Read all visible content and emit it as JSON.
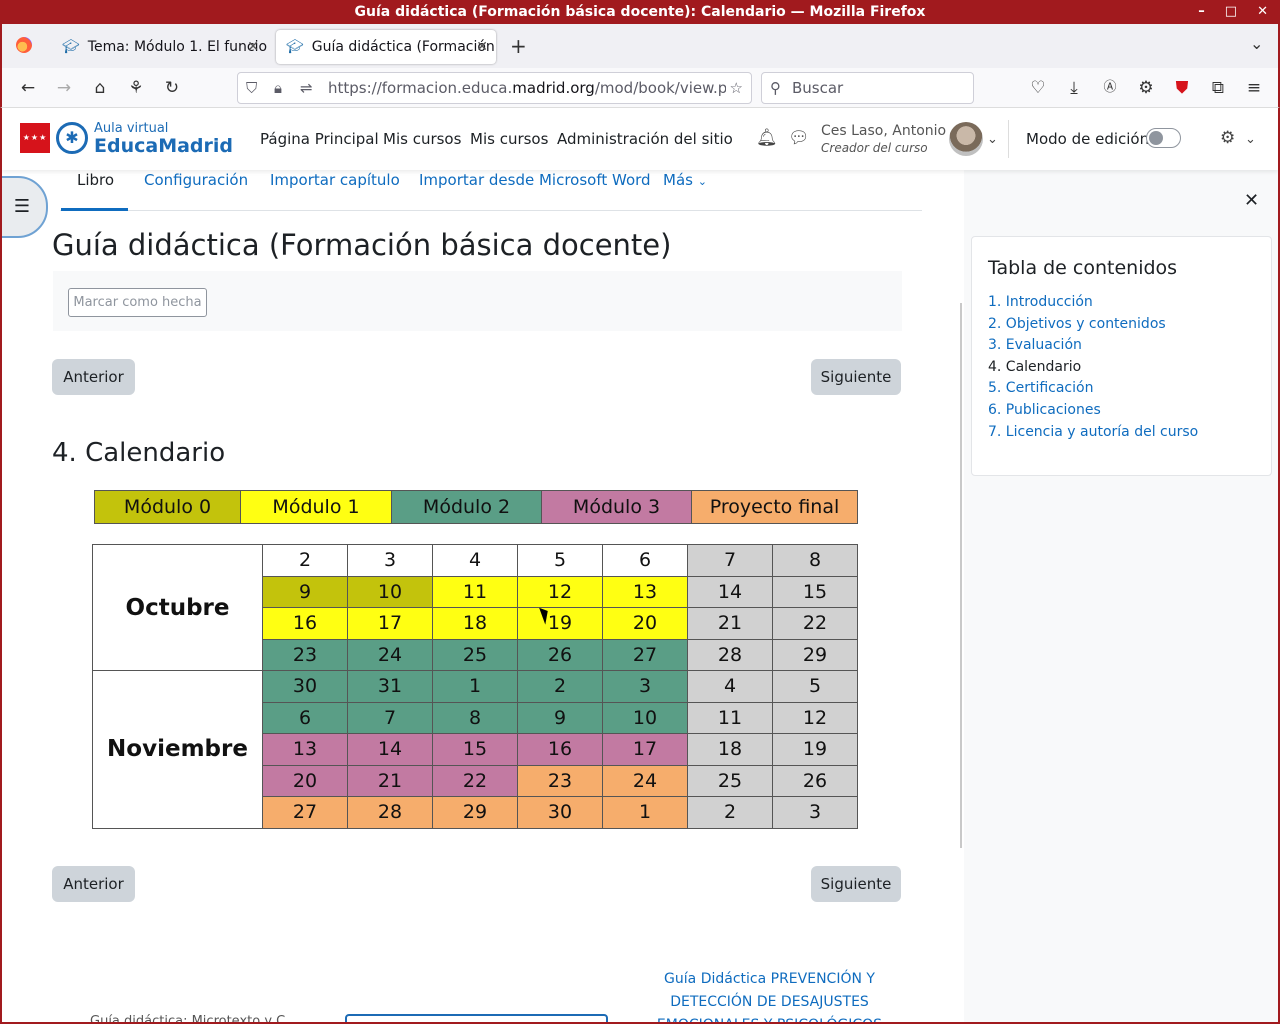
{
  "window": {
    "title": "Guía didáctica (Formación básica docente): Calendario — Mozilla Firefox",
    "controls": [
      "–",
      "□",
      "✕"
    ]
  },
  "browser": {
    "tabs": [
      {
        "label": "Tema: Módulo 1. El funcio"
      },
      {
        "label": "Guía didáctica (Formación"
      }
    ],
    "new_tab": "+",
    "url_prefix": "https://formacion.educa.",
    "url_domain": "madrid.org",
    "url_rest": "/mod/book/view.ph",
    "search_placeholder": "Buscar"
  },
  "header": {
    "logo_small": "Aula virtual",
    "logo_big": "EducaMadrid",
    "nav": [
      "Página Principal",
      "Mis cursos",
      "Mis cursos",
      "Administración del sitio"
    ],
    "user_name": "Ces Laso, Antonio",
    "user_role": "Creador del curso",
    "edit_mode_label": "Modo de edición"
  },
  "secondary_nav": {
    "items": [
      "Libro",
      "Configuración",
      "Importar capítulo",
      "Importar desde Microsoft Word",
      "Más"
    ]
  },
  "page": {
    "title": "Guía didáctica (Formación básica docente)",
    "mark_done": "Marcar como hecha",
    "prev": "Anterior",
    "next": "Siguiente",
    "chapter_title": "4. Calendario"
  },
  "calendar": {
    "legend": [
      {
        "label": "Módulo 0",
        "color": "#c3c30c"
      },
      {
        "label": "Módulo 1",
        "color": "#ffff12"
      },
      {
        "label": "Módulo 2",
        "color": "#5a9e86"
      },
      {
        "label": "Módulo 3",
        "color": "#c27aa2"
      },
      {
        "label": "Proyecto final",
        "color": "#f6ad6c"
      }
    ],
    "months": [
      "Octubre",
      "Noviembre"
    ],
    "rows": [
      {
        "days": [
          "2",
          "3",
          "4",
          "5",
          "6",
          "7",
          "8"
        ],
        "colors": [
          "w",
          "w",
          "w",
          "w",
          "w",
          "g",
          "g"
        ]
      },
      {
        "days": [
          "9",
          "10",
          "11",
          "12",
          "13",
          "14",
          "15"
        ],
        "colors": [
          "0",
          "0",
          "1",
          "1",
          "1",
          "g",
          "g"
        ]
      },
      {
        "days": [
          "16",
          "17",
          "18",
          "19",
          "20",
          "21",
          "22"
        ],
        "colors": [
          "1",
          "1",
          "1",
          "1",
          "1",
          "g",
          "g"
        ]
      },
      {
        "days": [
          "23",
          "24",
          "25",
          "26",
          "27",
          "28",
          "29"
        ],
        "colors": [
          "2",
          "2",
          "2",
          "2",
          "2",
          "g",
          "g"
        ]
      },
      {
        "days": [
          "30",
          "31",
          "1",
          "2",
          "3",
          "4",
          "5"
        ],
        "colors": [
          "2",
          "2",
          "2",
          "2",
          "2",
          "g",
          "g"
        ]
      },
      {
        "days": [
          "6",
          "7",
          "8",
          "9",
          "10",
          "11",
          "12"
        ],
        "colors": [
          "2",
          "2",
          "2",
          "2",
          "2",
          "g",
          "g"
        ]
      },
      {
        "days": [
          "13",
          "14",
          "15",
          "16",
          "17",
          "18",
          "19"
        ],
        "colors": [
          "3",
          "3",
          "3",
          "3",
          "3",
          "g",
          "g"
        ]
      },
      {
        "days": [
          "20",
          "21",
          "22",
          "23",
          "24",
          "25",
          "26"
        ],
        "colors": [
          "3",
          "3",
          "3",
          "f",
          "f",
          "g",
          "g"
        ]
      },
      {
        "days": [
          "27",
          "28",
          "29",
          "30",
          "1",
          "2",
          "3"
        ],
        "colors": [
          "f",
          "f",
          "f",
          "f",
          "f",
          "g",
          "g"
        ]
      }
    ]
  },
  "toc": {
    "title": "Tabla de contenidos",
    "items": [
      "1. Introducción",
      "2. Objetivos y contenidos",
      "3. Evaluación",
      "4. Calendario",
      "5. Certificación",
      "6. Publicaciones",
      "7. Licencia y autoría del curso"
    ],
    "current_index": 3
  },
  "footer": {
    "next_book": "Guía Didáctica PREVENCIÓN Y DETECCIÓN DE DESAJUSTES EMOCIONALES Y PSICOLÓGICOS",
    "left_text": "Guía didáctica: Microtexto y C"
  }
}
